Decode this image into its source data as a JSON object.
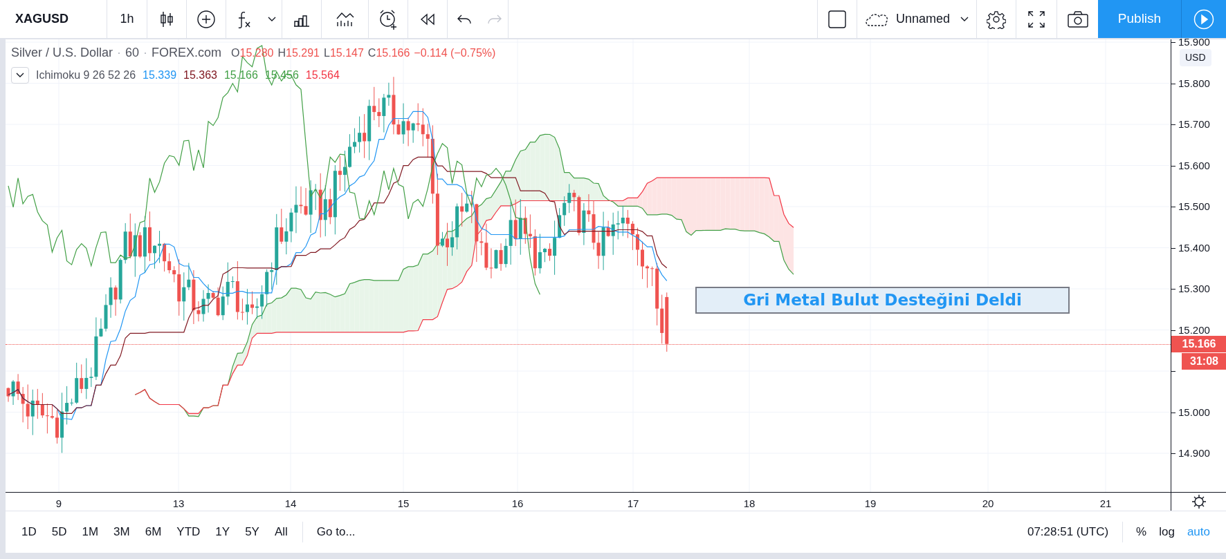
{
  "toolbar": {
    "symbol": "XAGUSD",
    "interval": "1h",
    "layout_name": "Unnamed",
    "publish": "Publish"
  },
  "legend": {
    "title": "Silver / U.S. Dollar",
    "separator": "·",
    "interval": "60",
    "exchange": "FOREX.com",
    "ohlc": [
      {
        "label": "O",
        "value": "15.280"
      },
      {
        "label": "H",
        "value": "15.291"
      },
      {
        "label": "L",
        "value": "15.147"
      },
      {
        "label": "C",
        "value": "15.166"
      }
    ],
    "change": "−0.114 (−0.75%)",
    "indicator": {
      "name": "Ichimoku 9 26 52 26",
      "values": [
        {
          "text": "15.339",
          "color": "#2196f3"
        },
        {
          "text": "15.363",
          "color": "#801922"
        },
        {
          "text": "15.166",
          "color": "#43a047"
        },
        {
          "text": "15.456",
          "color": "#43a047"
        },
        {
          "text": "15.564",
          "color": "#f23645"
        }
      ]
    }
  },
  "price_axis": {
    "currency": "USD",
    "ticks": [
      "15.900",
      "15.800",
      "15.700",
      "15.600",
      "15.500",
      "15.400",
      "15.300",
      "15.200"
    ],
    "ticks_below": [
      "15.000",
      "14.900"
    ],
    "last_price": "15.166",
    "countdown": "31:08"
  },
  "time_axis": {
    "ticks": [
      "9",
      "13",
      "14",
      "15",
      "16",
      "17",
      "18",
      "19",
      "20",
      "21"
    ]
  },
  "annotation": {
    "text": "Gri Metal Bulut Desteğini Deldi"
  },
  "bottom_bar": {
    "ranges": [
      "1D",
      "5D",
      "1M",
      "3M",
      "6M",
      "YTD",
      "1Y",
      "5Y",
      "All"
    ],
    "goto": "Go to...",
    "clock": "07:28:51 (UTC)",
    "scale_options": [
      {
        "label": "%",
        "selected": false
      },
      {
        "label": "log",
        "selected": false
      },
      {
        "label": "auto",
        "selected": true
      }
    ]
  }
}
